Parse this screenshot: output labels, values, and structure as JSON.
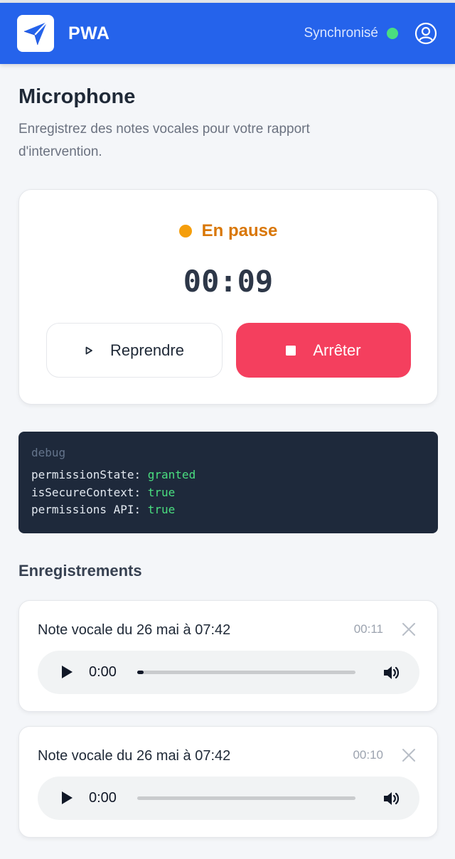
{
  "header": {
    "app_name": "PWA",
    "sync_status": "Synchronisé",
    "colors": {
      "primary": "#2563eb",
      "sync_dot": "#4ade80"
    },
    "icons": {
      "logo": "paper-plane-icon",
      "user": "user-circle-icon"
    }
  },
  "page": {
    "title": "Microphone",
    "description": "Enregistrez des notes vocales pour votre rapport d'intervention."
  },
  "recorder": {
    "status": "En pause",
    "status_color": "#d97706",
    "timer": "00:09",
    "resume_label": "Reprendre",
    "stop_label": "Arrêter",
    "stop_color": "#f43f5e",
    "icons": {
      "resume": "play-icon",
      "stop": "stop-icon"
    }
  },
  "debug": {
    "title": "debug",
    "lines": [
      {
        "key": "permissionState: ",
        "value": "granted"
      },
      {
        "key": "isSecureContext: ",
        "value": "true"
      },
      {
        "key": "permissions API: ",
        "value": "true"
      }
    ]
  },
  "recordings": {
    "title": "Enregistrements",
    "items": [
      {
        "name": "Note vocale du 26 mai à 07:42",
        "duration": "00:11",
        "current_time": "0:00",
        "progress": 0.03
      },
      {
        "name": "Note vocale du 26 mai à 07:42",
        "duration": "00:10",
        "current_time": "0:00",
        "progress": 0
      }
    ]
  }
}
